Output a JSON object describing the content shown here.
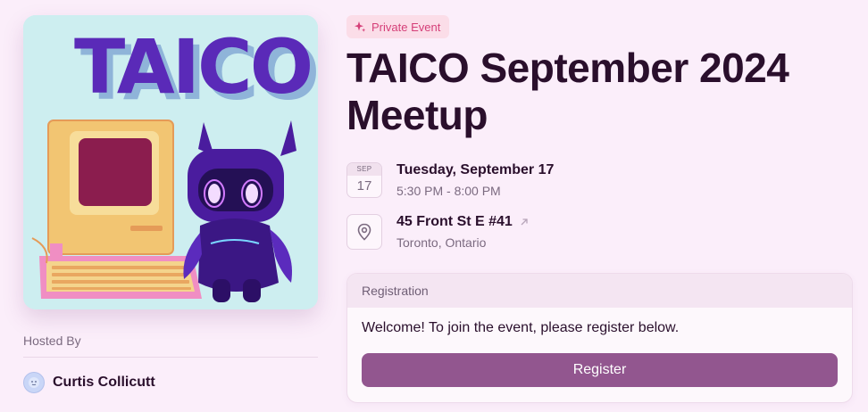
{
  "cover": {
    "text": "TAICO",
    "colors": {
      "background": "#cdeef0",
      "title_fill": "#5a2ab8",
      "title_shadow": "#8fb4d9",
      "computer": "#f2c572",
      "screen": "#8b1d4e",
      "robot": "#4a1c9e",
      "eyes": "#f3dcff"
    }
  },
  "host": {
    "label": "Hosted By",
    "name": "Curtis Collicutt",
    "avatar_icon": "face-icon"
  },
  "event": {
    "badge": "Private Event",
    "badge_icon": "sparkle-icon",
    "title": "TAICO September 2024 Meetup"
  },
  "date": {
    "month": "SEP",
    "day": "17",
    "full": "Tuesday, September 17",
    "time": "5:30 PM - 8:00 PM"
  },
  "location": {
    "icon": "map-pin-icon",
    "address": "45 Front St E #41",
    "link_icon": "arrow-up-right-icon",
    "city": "Toronto, Ontario"
  },
  "registration": {
    "header": "Registration",
    "message": "Welcome! To join the event, please register below.",
    "button_label": "Register",
    "button_color": "#92568f"
  }
}
